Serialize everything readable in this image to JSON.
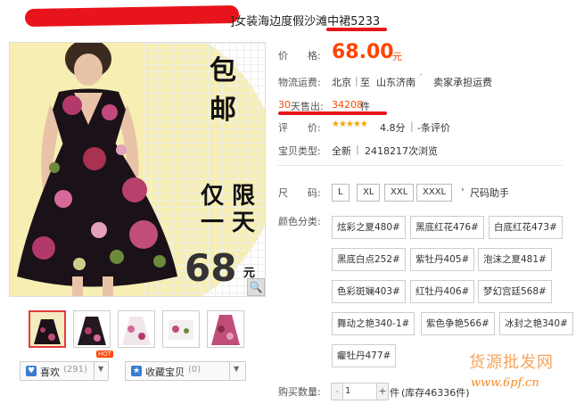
{
  "title": {
    "text": "]女装海边度假沙滩中裙5233"
  },
  "image": {
    "promo_top": "包 邮",
    "promo_mid": "仅 限\n一 天",
    "promo_price": "68",
    "promo_yuan": "元"
  },
  "price": {
    "label": "价　　格:",
    "value": "68.00",
    "unit": "元"
  },
  "shipping": {
    "label": "物流运费:",
    "from": "北京",
    "sep": "至",
    "to": "山东济南",
    "note": "卖家承担运费"
  },
  "sold": {
    "days": "30",
    "label": "天售出:",
    "value": "34208",
    "unit": "件"
  },
  "rating": {
    "label": "评　　价:",
    "stars": "★★★★★",
    "score": "4.8分",
    "comments": "-条评价"
  },
  "type": {
    "label": "宝贝类型:",
    "value": "全新",
    "views": "2418217次浏览"
  },
  "size": {
    "label": "尺　　码:",
    "options": [
      "L",
      "XL",
      "XXL",
      "XXXL"
    ],
    "helper": "尺码助手"
  },
  "colors": {
    "label": "颜色分类:",
    "options": [
      "炫彩之夏480#",
      "黑底红花476#",
      "白底红花473#",
      "黑底白点252#",
      "紫牡丹405#",
      "泡沫之夏481#",
      "色彩斑斓403#",
      "红牡丹406#",
      "梦幻宫廷568#",
      "舞动之艳340-1#",
      "紫色争艳566#",
      "冰封之艳340#",
      "癯牡丹477#"
    ]
  },
  "quantity": {
    "label": "购买数量:",
    "minus": "-",
    "value": "1",
    "plus": "+",
    "unit": "件",
    "stock": "(库存46336件)"
  },
  "social": {
    "like_label": "喜欢",
    "like_count": "(291)",
    "hot": "HOT",
    "fav_label": "收藏宝贝",
    "fav_count": "(0)"
  },
  "watermark": {
    "text": "货源批发网",
    "url": "www.6pf.cn"
  },
  "colors_theme": {
    "accent": "#ff4400",
    "redline": "#e8141b"
  }
}
